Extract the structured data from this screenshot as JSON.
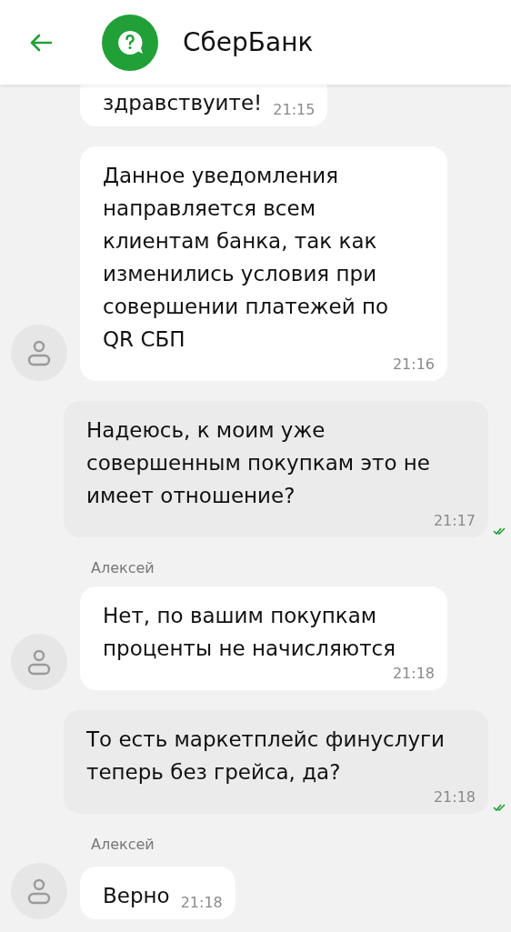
{
  "header": {
    "title": "СберБанк"
  },
  "messages": [
    {
      "kind": "incoming",
      "avatar": false,
      "text": "здравствуите!",
      "time": "21:15"
    },
    {
      "kind": "incoming",
      "avatar": true,
      "text": "Данное уведомления направляется всем клиентам банка, так как изменились условия при совершении платежей по QR СБП",
      "time": "21:16"
    },
    {
      "kind": "outgoing",
      "read": true,
      "text": "Надеюсь, к моим уже совершенным покупкам это не имеет отношение?",
      "time": "21:17"
    },
    {
      "kind": "incoming",
      "sender": "Алексей",
      "avatar": true,
      "text": "Нет, по вашим покупкам проценты не начисляются",
      "time": "21:18"
    },
    {
      "kind": "outgoing",
      "read": true,
      "text": "То есть маркетплейс финуслуги теперь без грейса, да?",
      "time": "21:18"
    },
    {
      "kind": "incoming",
      "sender": "Алексей",
      "avatar": true,
      "text": "Верно",
      "time": "21:18"
    }
  ]
}
